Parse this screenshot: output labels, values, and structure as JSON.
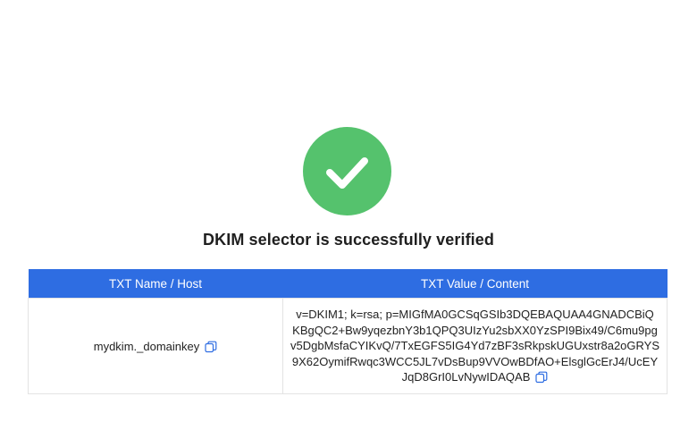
{
  "status": {
    "icon": "check-circle-icon",
    "color": "#55c26d",
    "message": "DKIM selector is successfully verified"
  },
  "table": {
    "accent_color": "#2e6de2",
    "headers": {
      "name": "TXT Name / Host",
      "value": "TXT Value / Content"
    },
    "row": {
      "name": "mydkim._domainkey",
      "value_lines": [
        "v=DKIM1; k=rsa; p=MIGfMA0GCSqGSIb3DQEBAQUAA4GNADCBiQ",
        "KBgQC2+Bw9yqezbnY3b1QPQ3UIzYu2sbXX0YzSPI9Bix49/C6mu9pg",
        "v5DgbMsfaCYIKvQ/7TxEGFS5IG4Yd7zBF3sRkpskUGUxstr8a2oGRYS",
        "9X62OymifRwqc3WCC5JL7vDsBup9VVOwBDfAO+ElsglGcErJ4/UcEY",
        "JqD8GrI0LvNywIDAQAB"
      ],
      "copy_icon": "copy-icon"
    }
  }
}
